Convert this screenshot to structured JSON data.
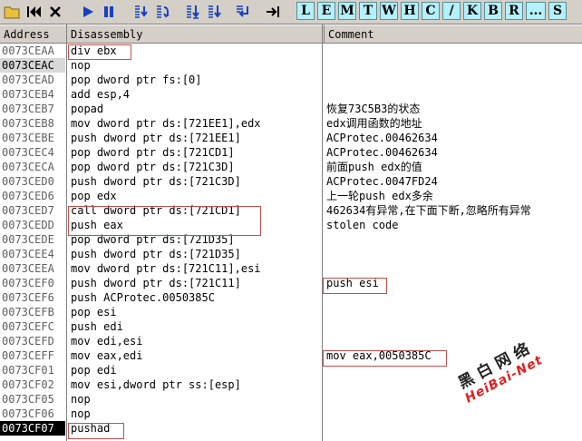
{
  "toolbar": {
    "letters": [
      "L",
      "E",
      "M",
      "T",
      "W",
      "H",
      "C",
      "/",
      "K",
      "B",
      "R",
      "...",
      "S"
    ]
  },
  "columns": {
    "address": "Address",
    "disassembly": "Disassembly",
    "comment": "Comment"
  },
  "rows": [
    {
      "addr": "0073CEAA",
      "dis": "div ebx",
      "com": ""
    },
    {
      "addr": "0073CEAC",
      "dis": "nop",
      "com": ""
    },
    {
      "addr": "0073CEAD",
      "dis": "pop dword ptr fs:[0]",
      "com": ""
    },
    {
      "addr": "0073CEB4",
      "dis": "add esp,4",
      "com": ""
    },
    {
      "addr": "0073CEB7",
      "dis": "popad",
      "com": "恢复73C5B3的状态"
    },
    {
      "addr": "0073CEB8",
      "dis": "mov dword ptr ds:[721EE1],edx",
      "com": "edx调用函数的地址"
    },
    {
      "addr": "0073CEBE",
      "dis": "push dword ptr ds:[721EE1]",
      "com": "ACProtec.00462634"
    },
    {
      "addr": "0073CEC4",
      "dis": "pop dword ptr ds:[721CD1]",
      "com": "ACProtec.00462634"
    },
    {
      "addr": "0073CECA",
      "dis": "pop dword ptr ds:[721C3D]",
      "com": "前面push edx的值"
    },
    {
      "addr": "0073CED0",
      "dis": "push dword ptr ds:[721C3D]",
      "com": "ACProtec.0047FD24"
    },
    {
      "addr": "0073CED6",
      "dis": "pop edx",
      "com": "上一轮push edx多余"
    },
    {
      "addr": "0073CED7",
      "dis": "call dword ptr ds:[721CD1]",
      "com": "462634有异常,在下面下断,忽略所有异常"
    },
    {
      "addr": "0073CEDD",
      "dis": "push eax",
      "com": "stolen code"
    },
    {
      "addr": "0073CEDE",
      "dis": "pop dword ptr ds:[721D35]",
      "com": ""
    },
    {
      "addr": "0073CEE4",
      "dis": "push dword ptr ds:[721D35]",
      "com": ""
    },
    {
      "addr": "0073CEEA",
      "dis": "mov dword ptr ds:[721C11],esi",
      "com": ""
    },
    {
      "addr": "0073CEF0",
      "dis": "push dword ptr ds:[721C11]",
      "com": "push esi"
    },
    {
      "addr": "0073CEF6",
      "dis": "push ACProtec.0050385C",
      "com": ""
    },
    {
      "addr": "0073CEFB",
      "dis": "pop esi",
      "com": ""
    },
    {
      "addr": "0073CEFC",
      "dis": "push edi",
      "com": ""
    },
    {
      "addr": "0073CEFD",
      "dis": "mov edi,esi",
      "com": ""
    },
    {
      "addr": "0073CEFF",
      "dis": "mov eax,edi",
      "com": "mov eax,0050385C"
    },
    {
      "addr": "0073CF01",
      "dis": "pop edi",
      "com": ""
    },
    {
      "addr": "0073CF02",
      "dis": "mov esi,dword ptr ss:[esp]",
      "com": ""
    },
    {
      "addr": "0073CF05",
      "dis": "nop",
      "com": ""
    },
    {
      "addr": "0073CF06",
      "dis": "nop",
      "com": ""
    },
    {
      "addr": "0073CF07",
      "dis": "pushad",
      "com": ""
    }
  ],
  "watermark": {
    "line1": "黑白网络",
    "line2": "HeiBai-Net"
  },
  "colors": {
    "highlight_box": "#c0504d",
    "toolbar_letter_bg": "#b4f0fa",
    "toolbar_icon": "#1a3fbf"
  }
}
